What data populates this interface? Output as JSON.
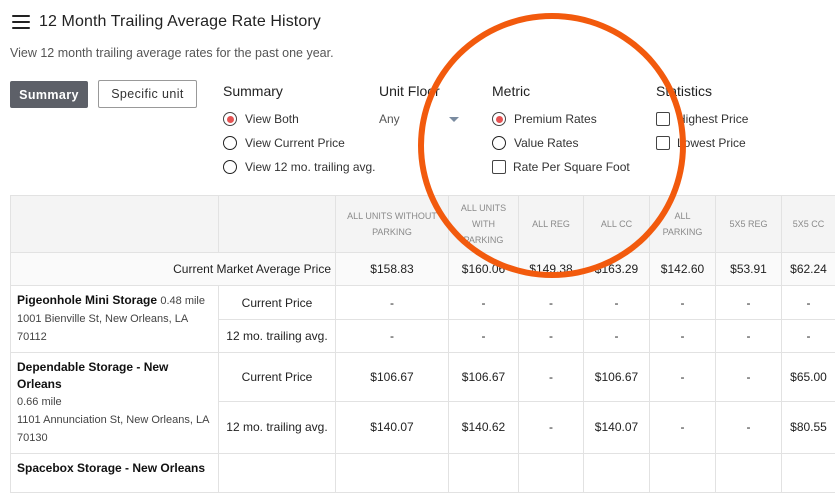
{
  "header": {
    "title": "12 Month Trailing Average Rate History",
    "subtitle": "View 12 month trailing average rates for the past one year."
  },
  "tabs": {
    "summary": "Summary",
    "specific": "Specific unit"
  },
  "summary_group": {
    "title": "Summary",
    "options": [
      "View Both",
      "View Current Price",
      "View 12 mo. trailing avg."
    ],
    "selected": 0
  },
  "unit_floor": {
    "title": "Unit Floor",
    "value": "Any"
  },
  "metric": {
    "title": "Metric",
    "options": [
      "Premium Rates",
      "Value Rates"
    ],
    "selected": 0,
    "checkbox": "Rate Per Square Foot"
  },
  "statistics": {
    "title": "Statistics",
    "options": [
      "Highest Price",
      "Lowest Price"
    ]
  },
  "table": {
    "columns": [
      "ALL UNITS WITHOUT PARKING",
      "ALL UNITS WITH PARKING",
      "ALL REG",
      "ALL CC",
      "ALL PARKING",
      "5X5 REG",
      "5X5 CC"
    ],
    "market_avg": {
      "label": "Current Market Average Price",
      "values": [
        "$158.83",
        "$160.06",
        "$149.38",
        "$163.29",
        "$142.60",
        "$53.91",
        "$62.24"
      ]
    },
    "stores": [
      {
        "name": "Pigeonhole Mini Storage",
        "distance": "0.48 mile",
        "address": "1001 Bienville St, New Orleans, LA 70112",
        "current_label": "Current Price",
        "current": [
          "-",
          "-",
          "-",
          "-",
          "-",
          "-",
          "-"
        ],
        "avg_label": "12 mo. trailing avg.",
        "avg": [
          "-",
          "-",
          "-",
          "-",
          "-",
          "-",
          "-"
        ]
      },
      {
        "name": "Dependable Storage - New Orleans",
        "distance": "0.66 mile",
        "address": "1101 Annunciation St, New Orleans, LA 70130",
        "current_label": "Current Price",
        "current": [
          "$106.67",
          "$106.67",
          "-",
          "$106.67",
          "-",
          "-",
          "$65.00"
        ],
        "avg_label": "12 mo. trailing avg.",
        "avg": [
          "$140.07",
          "$140.62",
          "-",
          "$140.07",
          "-",
          "-",
          "$80.55"
        ]
      },
      {
        "name": "Spacebox Storage - New Orleans"
      }
    ]
  },
  "annotation": {
    "ring_color": "#f25a0d"
  }
}
